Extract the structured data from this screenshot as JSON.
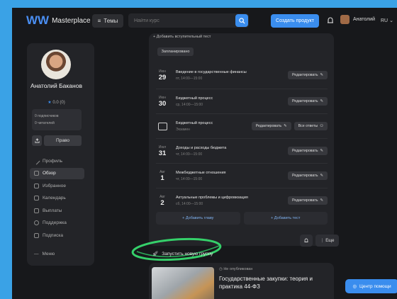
{
  "header": {
    "logo_mark": "W",
    "logo_text": "Masterplace",
    "topics_label": "Темы",
    "search_placeholder": "Найти курс",
    "create_label": "Создать продукт",
    "user_name": "Анатолий",
    "lang": "RU"
  },
  "profile": {
    "name": "Анатолий Баканов",
    "rating": "0.0 (0)",
    "subscribers": "0 подписчиков",
    "readers": "0 читателей",
    "right_button": "Право"
  },
  "sidebar": {
    "items": [
      {
        "label": "Профиль",
        "active": false
      },
      {
        "label": "Обзор",
        "active": true
      },
      {
        "label": "Избранное",
        "active": false
      },
      {
        "label": "Календарь",
        "active": false
      },
      {
        "label": "Выплаты",
        "active": false
      },
      {
        "label": "Поддержка",
        "active": false
      },
      {
        "label": "Подписка",
        "active": false
      }
    ],
    "more_label": "Меню"
  },
  "panel": {
    "add_intro_test": "+ Добавить вступительный тест",
    "test_chip": "Запланировано",
    "edit_label": "Редактировать",
    "all_answers_label": "Все ответы",
    "lessons": [
      {
        "month": "Июн",
        "day": "29",
        "title": "Введение в государственные финансы",
        "sub": "пт, 14:00—15:00"
      },
      {
        "month": "Июн",
        "day": "30",
        "title": "Бюджетный процесс",
        "sub": "ср, 14:00—15:00"
      },
      {
        "month": "",
        "day": "",
        "title": "Бюджетный процесс",
        "sub": "Экзамен"
      },
      {
        "month": "Июл",
        "day": "31",
        "title": "Доходы и расходы бюджета",
        "sub": "чт, 14:00—15:00"
      },
      {
        "month": "Авг",
        "day": "1",
        "title": "Межбюджетные отношения",
        "sub": "чт, 14:00—15:00"
      },
      {
        "month": "Авг",
        "day": "2",
        "title": "Актуальные проблемы и цифровизация",
        "sub": "сб, 14:00—15:00"
      }
    ],
    "add_topic": "+ Добавить главу",
    "add_test": "+ Добавить тест",
    "more_label": "Еще"
  },
  "launch_group": "Запустить новую группу",
  "course": {
    "status": "Не опубликован",
    "title": "Государственные закупки: теория и практика 44-ФЗ"
  },
  "help_label": "Центр помощи",
  "colors": {
    "accent": "#3a8dee",
    "highlight": "#35d06a",
    "background": "#3aa2e6"
  }
}
